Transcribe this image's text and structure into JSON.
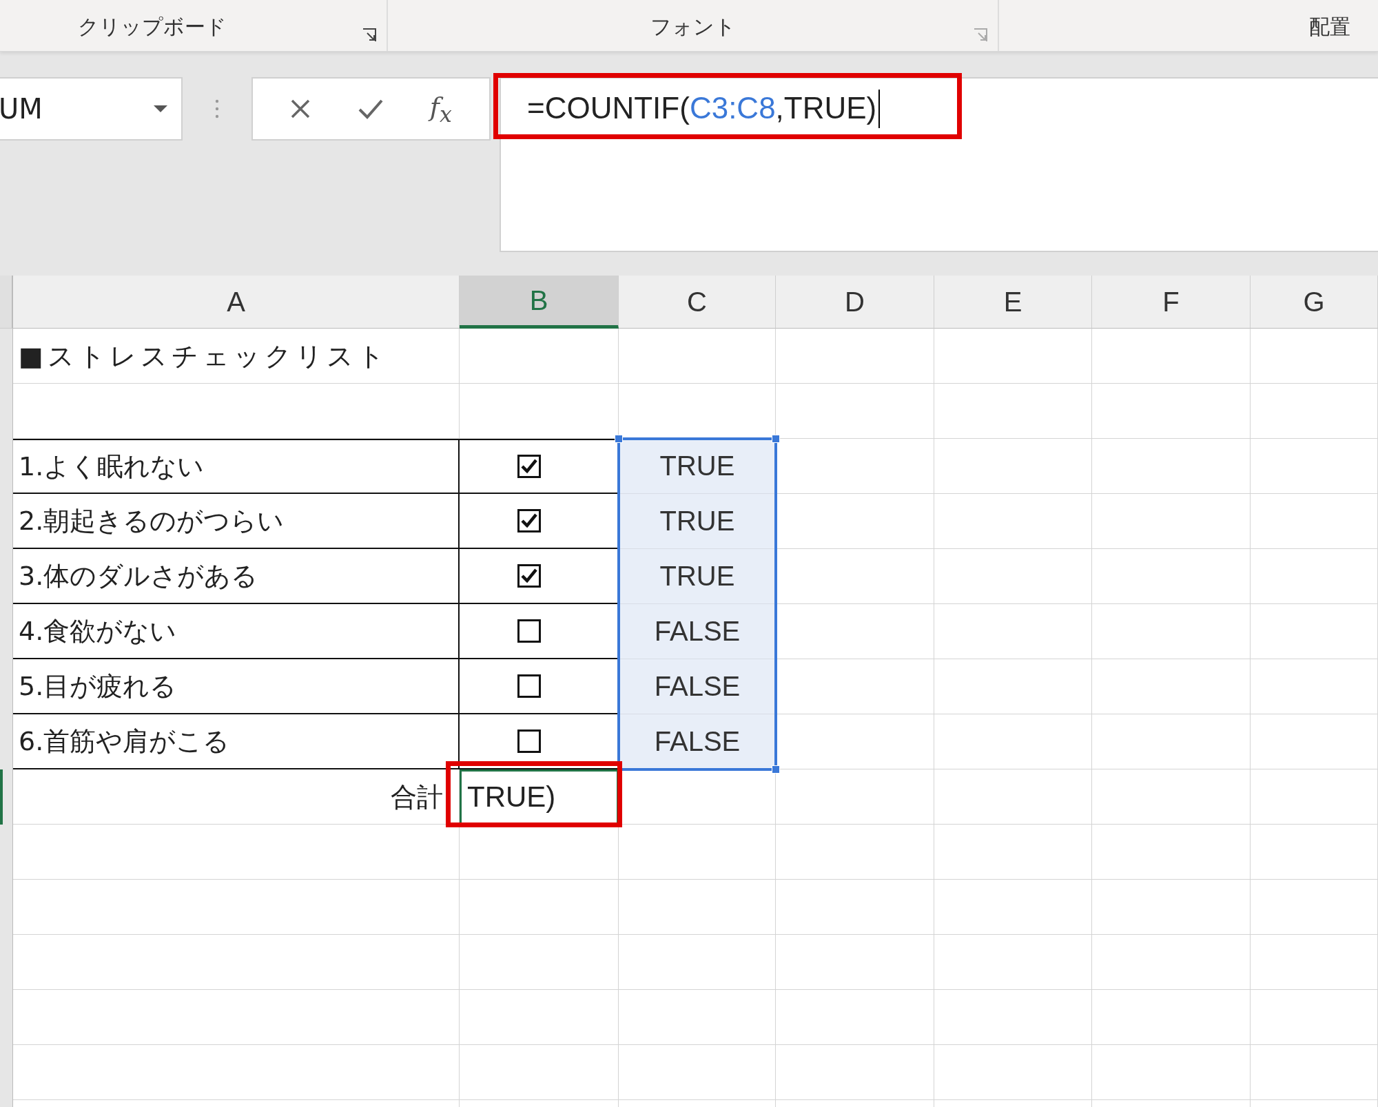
{
  "ribbon_groups": [
    {
      "label": "クリップボード",
      "launcher": true
    },
    {
      "label": "フォント",
      "launcher": true
    },
    {
      "label": "配置",
      "launcher": false
    }
  ],
  "name_box": {
    "value": "UM"
  },
  "formula_bar": {
    "function_label": "f$_{x}$",
    "parts": [
      {
        "text": "=COUNTIF(",
        "kind": "plain"
      },
      {
        "text": "C3:C8",
        "kind": "reference"
      },
      {
        "text": ",TRUE)",
        "kind": "plain"
      }
    ]
  },
  "columns": [
    {
      "label": "A",
      "selected": false
    },
    {
      "label": "B",
      "selected": true
    },
    {
      "label": "C",
      "selected": false
    },
    {
      "label": "D",
      "selected": false
    },
    {
      "label": "E",
      "selected": false
    },
    {
      "label": "F",
      "selected": false
    },
    {
      "label": "G",
      "selected": false
    }
  ],
  "title": "■ストレスチェックリスト",
  "items": [
    {
      "label": "1.よく眠れない",
      "checked": true,
      "value": "TRUE"
    },
    {
      "label": "2.朝起きるのがつらい",
      "checked": true,
      "value": "TRUE"
    },
    {
      "label": "3.体のダルさがある",
      "checked": true,
      "value": "TRUE"
    },
    {
      "label": "4.食欲がない",
      "checked": false,
      "value": "FALSE"
    },
    {
      "label": "5.目が疲れる",
      "checked": false,
      "value": "FALSE"
    },
    {
      "label": "6.首筋や肩がこる",
      "checked": false,
      "value": "FALSE"
    }
  ],
  "total": {
    "label": "合計",
    "editing_text": "TRUE)"
  }
}
